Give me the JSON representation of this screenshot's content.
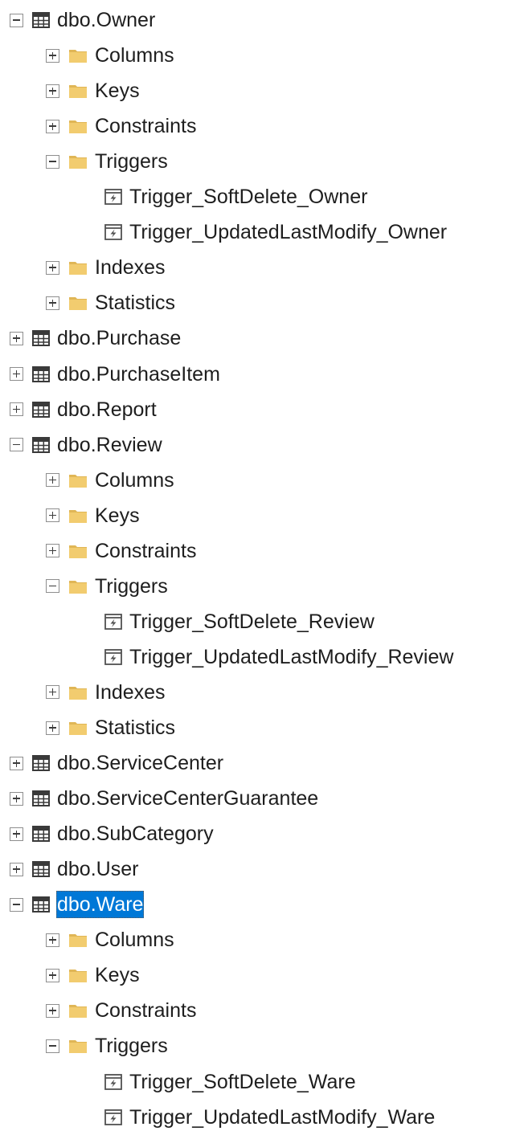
{
  "tree": [
    {
      "level": 0,
      "type": "table",
      "expander": "minus",
      "label": "dbo.Owner"
    },
    {
      "level": 1,
      "type": "folder",
      "expander": "plus",
      "label": "Columns"
    },
    {
      "level": 1,
      "type": "folder",
      "expander": "plus",
      "label": "Keys"
    },
    {
      "level": 1,
      "type": "folder",
      "expander": "plus",
      "label": "Constraints"
    },
    {
      "level": 1,
      "type": "folder",
      "expander": "minus",
      "label": "Triggers"
    },
    {
      "level": 2,
      "type": "trigger",
      "expander": "none",
      "label": "Trigger_SoftDelete_Owner"
    },
    {
      "level": 2,
      "type": "trigger",
      "expander": "none",
      "label": "Trigger_UpdatedLastModify_Owner"
    },
    {
      "level": 1,
      "type": "folder",
      "expander": "plus",
      "label": "Indexes"
    },
    {
      "level": 1,
      "type": "folder",
      "expander": "plus",
      "label": "Statistics"
    },
    {
      "level": 0,
      "type": "table",
      "expander": "plus",
      "label": "dbo.Purchase"
    },
    {
      "level": 0,
      "type": "table",
      "expander": "plus",
      "label": "dbo.PurchaseItem"
    },
    {
      "level": 0,
      "type": "table",
      "expander": "plus",
      "label": "dbo.Report"
    },
    {
      "level": 0,
      "type": "table",
      "expander": "minus",
      "label": "dbo.Review"
    },
    {
      "level": 1,
      "type": "folder",
      "expander": "plus",
      "label": "Columns"
    },
    {
      "level": 1,
      "type": "folder",
      "expander": "plus",
      "label": "Keys"
    },
    {
      "level": 1,
      "type": "folder",
      "expander": "plus",
      "label": "Constraints"
    },
    {
      "level": 1,
      "type": "folder",
      "expander": "minus",
      "label": "Triggers"
    },
    {
      "level": 2,
      "type": "trigger",
      "expander": "none",
      "label": "Trigger_SoftDelete_Review"
    },
    {
      "level": 2,
      "type": "trigger",
      "expander": "none",
      "label": "Trigger_UpdatedLastModify_Review"
    },
    {
      "level": 1,
      "type": "folder",
      "expander": "plus",
      "label": "Indexes"
    },
    {
      "level": 1,
      "type": "folder",
      "expander": "plus",
      "label": "Statistics"
    },
    {
      "level": 0,
      "type": "table",
      "expander": "plus",
      "label": "dbo.ServiceCenter"
    },
    {
      "level": 0,
      "type": "table",
      "expander": "plus",
      "label": "dbo.ServiceCenterGuarantee"
    },
    {
      "level": 0,
      "type": "table",
      "expander": "plus",
      "label": "dbo.SubCategory"
    },
    {
      "level": 0,
      "type": "table",
      "expander": "plus",
      "label": "dbo.User"
    },
    {
      "level": 0,
      "type": "table",
      "expander": "minus",
      "label": "dbo.Ware",
      "selected": true
    },
    {
      "level": 1,
      "type": "folder",
      "expander": "plus",
      "label": "Columns"
    },
    {
      "level": 1,
      "type": "folder",
      "expander": "plus",
      "label": "Keys"
    },
    {
      "level": 1,
      "type": "folder",
      "expander": "plus",
      "label": "Constraints"
    },
    {
      "level": 1,
      "type": "folder",
      "expander": "minus",
      "label": "Triggers"
    },
    {
      "level": 2,
      "type": "trigger",
      "expander": "none",
      "label": "Trigger_SoftDelete_Ware"
    },
    {
      "level": 2,
      "type": "trigger",
      "expander": "none",
      "label": "Trigger_UpdatedLastModify_Ware"
    }
  ],
  "colors": {
    "selection_bg": "#0078d7",
    "folder_body": "#f2cc6f",
    "folder_tab": "#e0b656",
    "table_icon": "#3a3a3a",
    "trigger_icon": "#505050"
  },
  "icons": {
    "table": "table-grid-icon",
    "folder": "folder-icon",
    "trigger": "trigger-script-icon",
    "plus": "expand-plus-icon",
    "minus": "collapse-minus-icon"
  }
}
